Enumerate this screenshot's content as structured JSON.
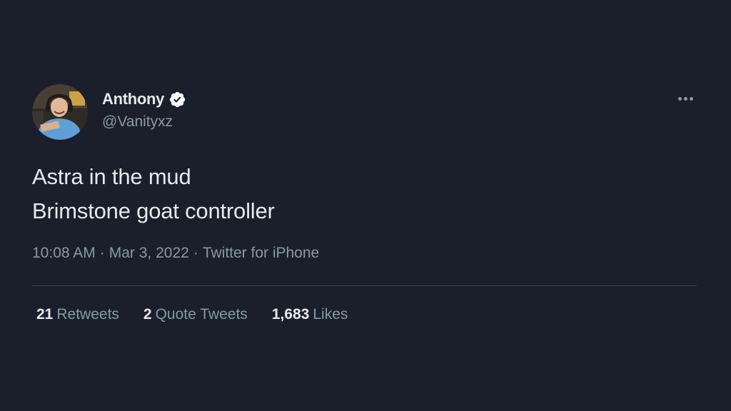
{
  "author": {
    "display_name": "Anthony",
    "handle": "@Vanityxz",
    "verified": true,
    "avatar_icon": "profile-photo"
  },
  "menu": {
    "icon": "more-horizontal-icon"
  },
  "tweet": {
    "lines": [
      "Astra in the mud",
      "Brimstone goat controller"
    ]
  },
  "meta": {
    "time": "10:08 AM",
    "separator": "·",
    "date": "Mar 3, 2022",
    "source": "Twitter for iPhone"
  },
  "stats": [
    {
      "count": "21",
      "label": "Retweets"
    },
    {
      "count": "2",
      "label": "Quote Tweets"
    },
    {
      "count": "1,683",
      "label": "Likes"
    }
  ],
  "colors": {
    "background": "#1a1f2b",
    "primary_text": "#e7e9ea",
    "secondary_text": "#8b98a5",
    "divider": "#3a434e",
    "verified_badge": "#ffffff"
  }
}
